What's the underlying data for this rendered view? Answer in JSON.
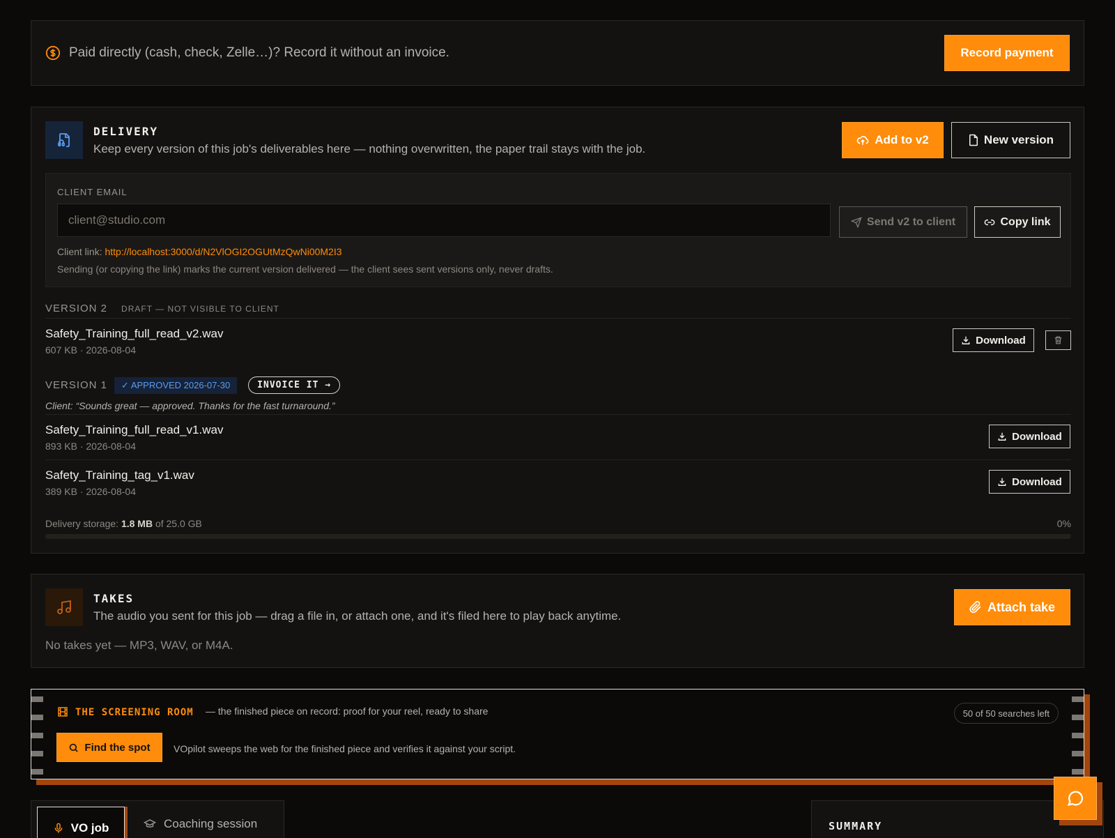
{
  "payment": {
    "text": "Paid directly (cash, check, Zelle…)? Record it without an invoice.",
    "button": "Record payment"
  },
  "delivery": {
    "title": "DELIVERY",
    "description": "Keep every version of this job's deliverables here — nothing overwritten, the paper trail stays with the job.",
    "add_button": "Add to v2",
    "new_version_button": "New version",
    "client_email_label": "CLIENT EMAIL",
    "email_placeholder": "client@studio.com",
    "send_button": "Send v2 to client",
    "copy_button": "Copy link",
    "client_link_label": "Client link:",
    "client_link_url": "http://localhost:3000/d/N2VlOGI2OGUtMzQwNi00M2I3",
    "note": "Sending (or copying the link) marks the current version delivered — the client sees sent versions only, never drafts.",
    "versions": [
      {
        "label": "VERSION 2",
        "status": "DRAFT — NOT VISIBLE TO CLIENT",
        "files": [
          {
            "name": "Safety_Training_full_read_v2.wav",
            "meta": "607 KB · 2026-08-04"
          }
        ]
      },
      {
        "label": "VERSION 1",
        "approved": "✓ APPROVED 2026-07-30",
        "invoice": "INVOICE IT →",
        "comment": "Client: “Sounds great — approved. Thanks for the fast turnaround.”",
        "files": [
          {
            "name": "Safety_Training_full_read_v1.wav",
            "meta": "893 KB · 2026-08-04"
          },
          {
            "name": "Safety_Training_tag_v1.wav",
            "meta": "389 KB · 2026-08-04"
          }
        ]
      }
    ],
    "download_label": "Download",
    "storage_prefix": "Delivery storage:",
    "storage_used": "1.8 MB",
    "storage_total": "of 25.0 GB",
    "storage_percent": "0%",
    "storage_fraction": 0.0
  },
  "takes": {
    "title": "TAKES",
    "description": "The audio you sent for this job — drag a file in, or attach one, and it's filed here to play back anytime.",
    "button": "Attach take",
    "empty": "No takes yet — MP3, WAV, or M4A."
  },
  "screening": {
    "title": "THE SCREENING ROOM",
    "subtitle": "— the finished piece on record: proof for your reel, ready to share",
    "searches": "50 of 50 searches left",
    "button": "Find the spot",
    "description": "VOpilot sweeps the web for the finished piece and verifies it against your script."
  },
  "tabs": {
    "vo_job": "VO job",
    "coaching": "Coaching session"
  },
  "summary": {
    "title": "SUMMARY"
  },
  "colors": {
    "accent": "#ff8c0a",
    "approved": "#5b9cf0",
    "shadow": "#a3460e"
  }
}
